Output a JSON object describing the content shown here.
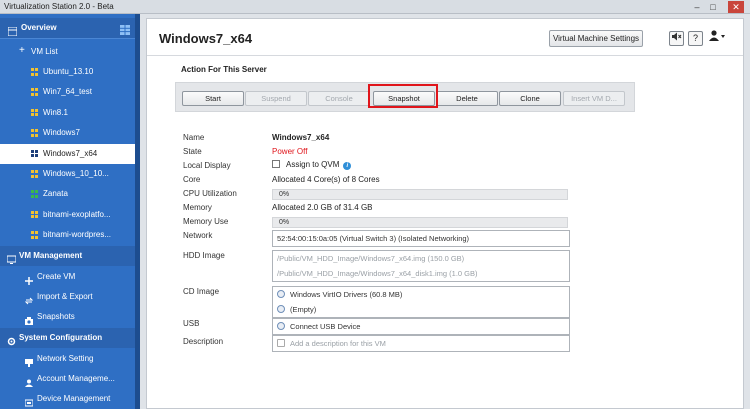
{
  "window": {
    "title": "Virtualization Station 2.0 - Beta",
    "controls": [
      "–",
      "□",
      "✕"
    ]
  },
  "sidebar": {
    "overview": "Overview",
    "vm_list": "VM List",
    "vms": [
      {
        "label": "Ubuntu_13.10",
        "color": "#f2c230"
      },
      {
        "label": "Win7_64_test",
        "color": "#f2c230"
      },
      {
        "label": "Win8.1",
        "color": "#f2c230"
      },
      {
        "label": "Windows7",
        "color": "#f2c230"
      },
      {
        "label": "Windows7_x64",
        "color": "#1f3f7a"
      },
      {
        "label": "Windows_10_10...",
        "color": "#f2c230"
      },
      {
        "label": "Zanata",
        "color": "#3cb84a"
      },
      {
        "label": "bitnami-exoplatfo...",
        "color": "#f2c230"
      },
      {
        "label": "bitnami-wordpres...",
        "color": "#f2c230"
      }
    ],
    "vm_management": "VM Management",
    "management_items": [
      "Create VM",
      "Import & Export",
      "Snapshots"
    ],
    "system_configuration": "System Configuration",
    "config_items": [
      "Network Setting",
      "Account Manageme...",
      "Device Management"
    ]
  },
  "main": {
    "title": "Windows7_x64",
    "vm_settings_button": "Virtual Machine Settings",
    "section_title": "Action For This Server",
    "actions": [
      {
        "label": "Start",
        "enabled": true
      },
      {
        "label": "Suspend",
        "enabled": false
      },
      {
        "label": "Console",
        "enabled": false
      },
      {
        "label": "Snapshot",
        "enabled": true
      },
      {
        "label": "Delete",
        "enabled": true
      },
      {
        "label": "Clone",
        "enabled": true
      },
      {
        "label": "Insert VM D...",
        "enabled": false
      }
    ],
    "props": {
      "name_label": "Name",
      "name": "Windows7_x64",
      "state_label": "State",
      "state": "Power Off",
      "state_color": "#e0151b",
      "local_display_label": "Local Display",
      "local_display": "Assign to QVM",
      "core_label": "Core",
      "core": "Allocated 4 Core(s) of 8 Cores",
      "cpu_label": "CPU Utilization",
      "cpu": "0%",
      "memory_label": "Memory",
      "memory": "Allocated 2.0 GB of 31.4 GB",
      "memory_use_label": "Memory Use",
      "memory_use": "0%",
      "network_label": "Network",
      "network": "52:54:00:15:0a:05 (Virtual Switch 3) (Isolated Networking)",
      "hdd_label": "HDD Image",
      "hdd": [
        "/Public/VM_HDD_Image/Windows7_x64.img (150.0 GB)",
        "/Public/VM_HDD_Image/Windows7_x64_disk1.img (1.0 GB)"
      ],
      "cd_label": "CD Image",
      "cd": [
        "Windows VirtIO Drivers (60.8 MB)",
        "(Empty)"
      ],
      "usb_label": "USB",
      "usb": "Connect USB Device",
      "description_label": "Description",
      "description_placeholder": "Add a description for this VM"
    }
  }
}
